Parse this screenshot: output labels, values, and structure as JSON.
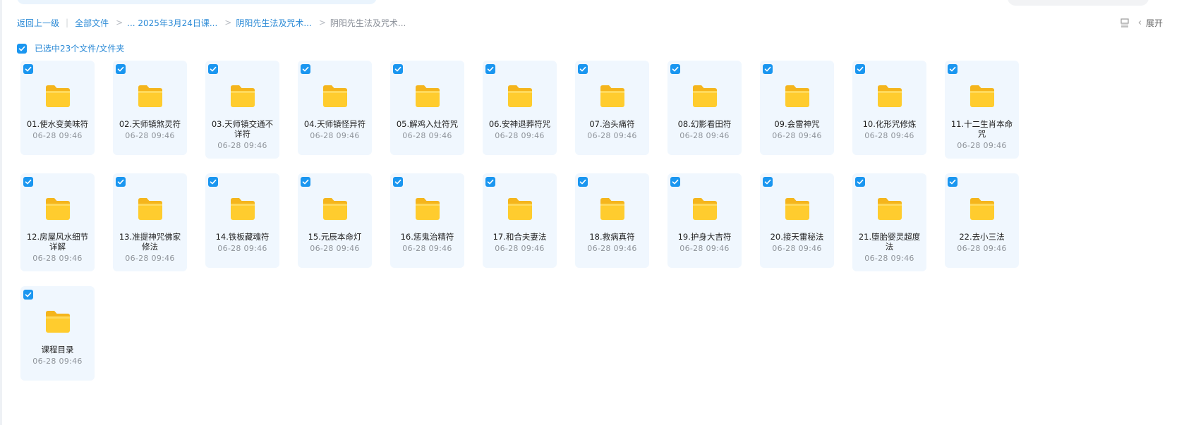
{
  "breadcrumb": {
    "back": "返回上一级",
    "items": [
      "全部文件",
      "... 2025年3月24日课...",
      "阴阳先生法及咒术..."
    ],
    "current": "阴阳先生法及咒术..."
  },
  "toolbar": {
    "expand_label": "展开"
  },
  "selection": {
    "label": "已选中23个文件/文件夹"
  },
  "colors": {
    "accent": "#1a96f0",
    "folder": "#ffc928",
    "tile_bg": "#f0f7fe"
  },
  "files": [
    {
      "name": "01.使水变美味符",
      "date": "06-28 09:46"
    },
    {
      "name": "02.天师镇煞灵符",
      "date": "06-28 09:46"
    },
    {
      "name": "03.天师镇交通不详符",
      "date": "06-28 09:46"
    },
    {
      "name": "04.天师镇怪异符",
      "date": "06-28 09:46"
    },
    {
      "name": "05.解鸡入灶符咒",
      "date": "06-28 09:46"
    },
    {
      "name": "06.安神退葬符咒",
      "date": "06-28 09:46"
    },
    {
      "name": "07.治头痛符",
      "date": "06-28 09:46"
    },
    {
      "name": "08.幻影看田符",
      "date": "06-28 09:46"
    },
    {
      "name": "09.会雷神咒",
      "date": "06-28 09:46"
    },
    {
      "name": "10.化形咒修炼",
      "date": "06-28 09:46"
    },
    {
      "name": "11.十二生肖本命咒",
      "date": "06-28 09:46"
    },
    {
      "name": "12.房屋风水细节详解",
      "date": "06-28 09:46"
    },
    {
      "name": "13.准提神咒佛家修法",
      "date": "06-28 09:46"
    },
    {
      "name": "14.铁板藏魂符",
      "date": "06-28 09:46"
    },
    {
      "name": "15.元辰本命灯",
      "date": "06-28 09:46"
    },
    {
      "name": "16.惩鬼治精符",
      "date": "06-28 09:46"
    },
    {
      "name": "17.和合夫妻法",
      "date": "06-28 09:46"
    },
    {
      "name": "18.救病真符",
      "date": "06-28 09:46"
    },
    {
      "name": "19.护身大吉符",
      "date": "06-28 09:46"
    },
    {
      "name": "20.接天雷秘法",
      "date": "06-28 09:46"
    },
    {
      "name": "21.堕胎婴灵超度法",
      "date": "06-28 09:46"
    },
    {
      "name": "22.去小三法",
      "date": "06-28 09:46"
    },
    {
      "name": "课程目录",
      "date": "06-28 09:46"
    }
  ]
}
